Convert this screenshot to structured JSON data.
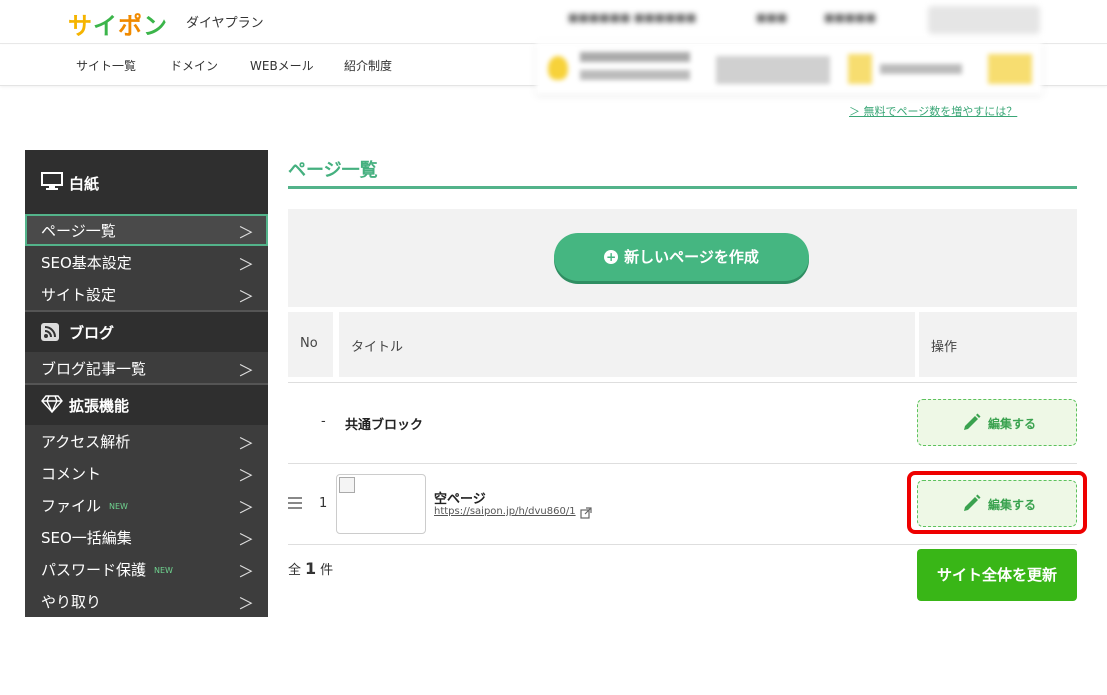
{
  "header": {
    "logo": [
      "サ",
      "イ",
      "ポ",
      "ン"
    ],
    "plan": "ダイヤプラン"
  },
  "nav": {
    "items": [
      "サイト一覧",
      "ドメイン",
      "WEBメール",
      "紹介制度"
    ]
  },
  "help_link": "＞ 無料でページ数を増やすには？",
  "sidebar": {
    "site_name": "白紙",
    "site_items": [
      "ページ一覧",
      "SEO基本設定",
      "サイト設定"
    ],
    "blog_heading": "ブログ",
    "blog_items": [
      "ブログ記事一覧"
    ],
    "ext_heading": "拡張機能",
    "ext_items": [
      {
        "label": "アクセス解析",
        "badge": ""
      },
      {
        "label": "コメント",
        "badge": ""
      },
      {
        "label": "ファイル",
        "badge": "NEW"
      },
      {
        "label": "SEO一括編集",
        "badge": ""
      },
      {
        "label": "パスワード保護",
        "badge": "NEW"
      },
      {
        "label": "やり取り",
        "badge": ""
      }
    ],
    "chevron": "＞"
  },
  "main": {
    "title": "ページ一覧",
    "create_button": "新しいページを作成",
    "create_plus": "+",
    "columns": [
      "No",
      "タイトル",
      "操作"
    ],
    "common_row": {
      "no": "-",
      "title": "共通ブロック",
      "action": "編集する"
    },
    "rows": [
      {
        "no": "1",
        "title": "空ページ",
        "url": "https://saipon.jp/h/dvu860/1",
        "action": "編集する"
      }
    ],
    "count_prefix": "全",
    "count_value": "1",
    "count_suffix": "件",
    "update_button": "サイト全体を更新"
  },
  "colors": {
    "accent": "#45b07f",
    "update": "#39b617",
    "highlight": "#e00000"
  }
}
